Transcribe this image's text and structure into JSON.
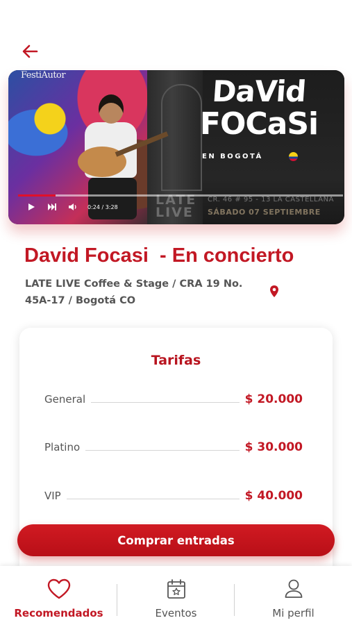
{
  "colors": {
    "accent": "#c21824",
    "text": "#555555",
    "progress": "#e0102a"
  },
  "header": {
    "back_icon": "arrow-left-icon"
  },
  "video": {
    "brand_logo": "FestiAutor",
    "poster_title_line1": "DaVid",
    "poster_title_line2": "FOCaSi",
    "poster_subtitle": "EN BOGOTÁ",
    "poster_venue": "LATE\nLIVE",
    "poster_address": "CR. 46 # 95 - 13 LA CASTELLANA",
    "poster_date": "SÁBADO 07 SEPTIEMBRE",
    "time_display": "0:24 / 3:28",
    "progress_fraction": 0.115
  },
  "event": {
    "title": "David Focasi  - En concierto",
    "venue": "LATE LIVE Coffee & Stage / CRA 19 No. 45A-17 / Bogotá CO",
    "location_icon": "location-pin-icon"
  },
  "tarifas": {
    "title": "Tarifas",
    "items": [
      {
        "name": "General",
        "price": "$ 20.000"
      },
      {
        "name": "Platino",
        "price": "$ 30.000"
      },
      {
        "name": "VIP",
        "price": "$ 40.000"
      }
    ]
  },
  "buy_button": {
    "label": "Comprar entradas"
  },
  "bottom_nav": {
    "items": [
      {
        "label": "Recomendados",
        "icon": "heart-icon",
        "active": true
      },
      {
        "label": "Eventos",
        "icon": "calendar-star-icon",
        "active": false
      },
      {
        "label": "Mi perfil",
        "icon": "user-icon",
        "active": false
      }
    ]
  }
}
